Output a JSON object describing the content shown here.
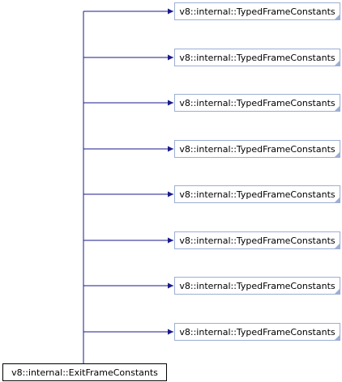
{
  "diagram": {
    "root": {
      "label": "v8::internal::ExitFrameConstants"
    },
    "parents": [
      {
        "label": "v8::internal::TypedFrameConstants"
      },
      {
        "label": "v8::internal::TypedFrameConstants"
      },
      {
        "label": "v8::internal::TypedFrameConstants"
      },
      {
        "label": "v8::internal::TypedFrameConstants"
      },
      {
        "label": "v8::internal::TypedFrameConstants"
      },
      {
        "label": "v8::internal::TypedFrameConstants"
      },
      {
        "label": "v8::internal::TypedFrameConstants"
      },
      {
        "label": "v8::internal::TypedFrameConstants"
      }
    ],
    "colors": {
      "edge": "#1a1a8c",
      "parent_border": "#9caed4",
      "root_border": "#000000"
    },
    "relation": "inherits-from"
  }
}
